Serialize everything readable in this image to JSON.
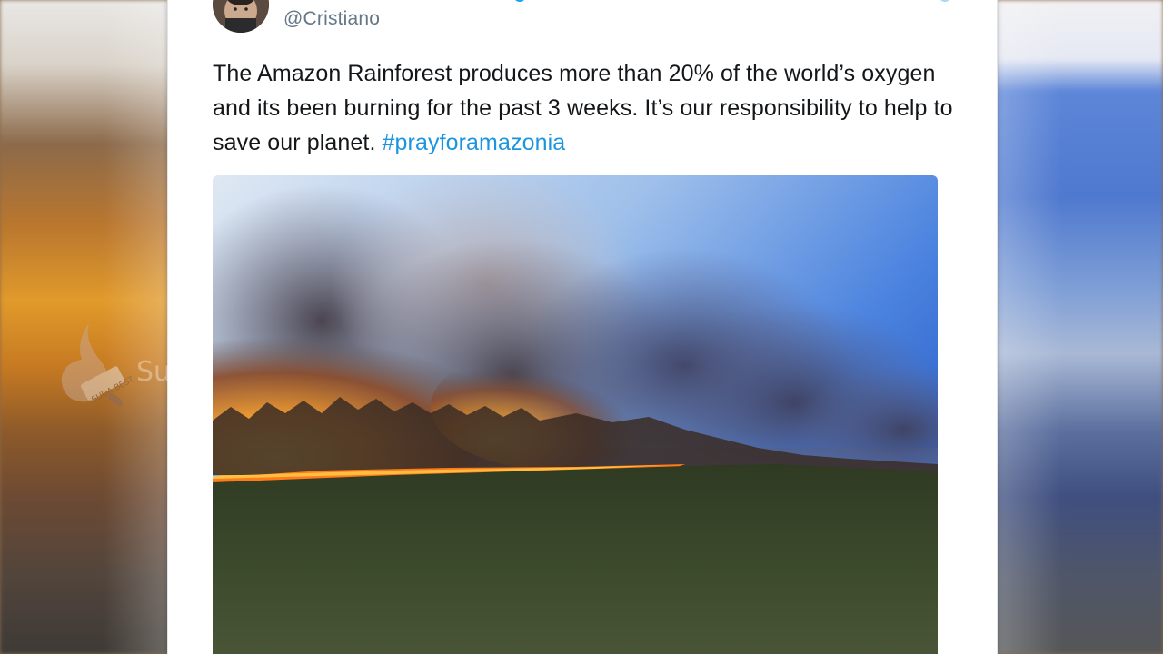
{
  "tweet": {
    "handle": "@Cristiano",
    "text_before_hashtag": "The Amazon Rainforest produces more than 20% of the world’s oxygen and its been burning for the past 3 weeks. It’s our responsibility to help to save our planet.",
    "hashtag": "#prayforamazonia",
    "colors": {
      "text": "#14171a",
      "handle": "#657786",
      "hashtag": "#1b95e0",
      "verified": "#1da1f2"
    }
  },
  "media": {
    "icon": "wildfire-photo"
  },
  "watermark": {
    "badge_text": "SUDA BEST",
    "text": "Suda"
  }
}
